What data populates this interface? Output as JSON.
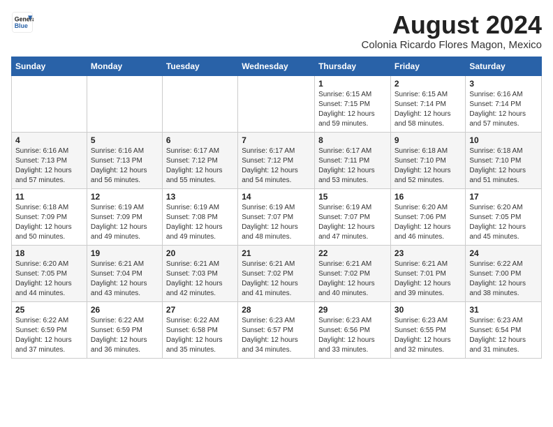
{
  "header": {
    "logo_line1": "General",
    "logo_line2": "Blue",
    "month_year": "August 2024",
    "location": "Colonia Ricardo Flores Magon, Mexico"
  },
  "weekdays": [
    "Sunday",
    "Monday",
    "Tuesday",
    "Wednesday",
    "Thursday",
    "Friday",
    "Saturday"
  ],
  "weeks": [
    [
      {
        "day": "",
        "info": ""
      },
      {
        "day": "",
        "info": ""
      },
      {
        "day": "",
        "info": ""
      },
      {
        "day": "",
        "info": ""
      },
      {
        "day": "1",
        "info": "Sunrise: 6:15 AM\nSunset: 7:15 PM\nDaylight: 12 hours\nand 59 minutes."
      },
      {
        "day": "2",
        "info": "Sunrise: 6:15 AM\nSunset: 7:14 PM\nDaylight: 12 hours\nand 58 minutes."
      },
      {
        "day": "3",
        "info": "Sunrise: 6:16 AM\nSunset: 7:14 PM\nDaylight: 12 hours\nand 57 minutes."
      }
    ],
    [
      {
        "day": "4",
        "info": "Sunrise: 6:16 AM\nSunset: 7:13 PM\nDaylight: 12 hours\nand 57 minutes."
      },
      {
        "day": "5",
        "info": "Sunrise: 6:16 AM\nSunset: 7:13 PM\nDaylight: 12 hours\nand 56 minutes."
      },
      {
        "day": "6",
        "info": "Sunrise: 6:17 AM\nSunset: 7:12 PM\nDaylight: 12 hours\nand 55 minutes."
      },
      {
        "day": "7",
        "info": "Sunrise: 6:17 AM\nSunset: 7:12 PM\nDaylight: 12 hours\nand 54 minutes."
      },
      {
        "day": "8",
        "info": "Sunrise: 6:17 AM\nSunset: 7:11 PM\nDaylight: 12 hours\nand 53 minutes."
      },
      {
        "day": "9",
        "info": "Sunrise: 6:18 AM\nSunset: 7:10 PM\nDaylight: 12 hours\nand 52 minutes."
      },
      {
        "day": "10",
        "info": "Sunrise: 6:18 AM\nSunset: 7:10 PM\nDaylight: 12 hours\nand 51 minutes."
      }
    ],
    [
      {
        "day": "11",
        "info": "Sunrise: 6:18 AM\nSunset: 7:09 PM\nDaylight: 12 hours\nand 50 minutes."
      },
      {
        "day": "12",
        "info": "Sunrise: 6:19 AM\nSunset: 7:09 PM\nDaylight: 12 hours\nand 49 minutes."
      },
      {
        "day": "13",
        "info": "Sunrise: 6:19 AM\nSunset: 7:08 PM\nDaylight: 12 hours\nand 49 minutes."
      },
      {
        "day": "14",
        "info": "Sunrise: 6:19 AM\nSunset: 7:07 PM\nDaylight: 12 hours\nand 48 minutes."
      },
      {
        "day": "15",
        "info": "Sunrise: 6:19 AM\nSunset: 7:07 PM\nDaylight: 12 hours\nand 47 minutes."
      },
      {
        "day": "16",
        "info": "Sunrise: 6:20 AM\nSunset: 7:06 PM\nDaylight: 12 hours\nand 46 minutes."
      },
      {
        "day": "17",
        "info": "Sunrise: 6:20 AM\nSunset: 7:05 PM\nDaylight: 12 hours\nand 45 minutes."
      }
    ],
    [
      {
        "day": "18",
        "info": "Sunrise: 6:20 AM\nSunset: 7:05 PM\nDaylight: 12 hours\nand 44 minutes."
      },
      {
        "day": "19",
        "info": "Sunrise: 6:21 AM\nSunset: 7:04 PM\nDaylight: 12 hours\nand 43 minutes."
      },
      {
        "day": "20",
        "info": "Sunrise: 6:21 AM\nSunset: 7:03 PM\nDaylight: 12 hours\nand 42 minutes."
      },
      {
        "day": "21",
        "info": "Sunrise: 6:21 AM\nSunset: 7:02 PM\nDaylight: 12 hours\nand 41 minutes."
      },
      {
        "day": "22",
        "info": "Sunrise: 6:21 AM\nSunset: 7:02 PM\nDaylight: 12 hours\nand 40 minutes."
      },
      {
        "day": "23",
        "info": "Sunrise: 6:21 AM\nSunset: 7:01 PM\nDaylight: 12 hours\nand 39 minutes."
      },
      {
        "day": "24",
        "info": "Sunrise: 6:22 AM\nSunset: 7:00 PM\nDaylight: 12 hours\nand 38 minutes."
      }
    ],
    [
      {
        "day": "25",
        "info": "Sunrise: 6:22 AM\nSunset: 6:59 PM\nDaylight: 12 hours\nand 37 minutes."
      },
      {
        "day": "26",
        "info": "Sunrise: 6:22 AM\nSunset: 6:59 PM\nDaylight: 12 hours\nand 36 minutes."
      },
      {
        "day": "27",
        "info": "Sunrise: 6:22 AM\nSunset: 6:58 PM\nDaylight: 12 hours\nand 35 minutes."
      },
      {
        "day": "28",
        "info": "Sunrise: 6:23 AM\nSunset: 6:57 PM\nDaylight: 12 hours\nand 34 minutes."
      },
      {
        "day": "29",
        "info": "Sunrise: 6:23 AM\nSunset: 6:56 PM\nDaylight: 12 hours\nand 33 minutes."
      },
      {
        "day": "30",
        "info": "Sunrise: 6:23 AM\nSunset: 6:55 PM\nDaylight: 12 hours\nand 32 minutes."
      },
      {
        "day": "31",
        "info": "Sunrise: 6:23 AM\nSunset: 6:54 PM\nDaylight: 12 hours\nand 31 minutes."
      }
    ]
  ]
}
